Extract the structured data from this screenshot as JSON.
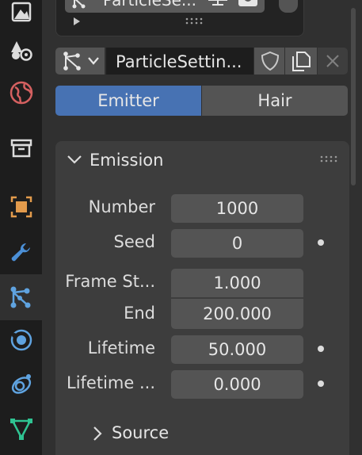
{
  "tabs": [
    {
      "icon": "render-icon"
    },
    {
      "icon": "scene-icon"
    },
    {
      "icon": "world-icon"
    },
    {
      "icon": "collection-icon"
    },
    {
      "icon": "object-icon"
    },
    {
      "icon": "modifier-icon"
    },
    {
      "icon": "particles-icon",
      "active": true
    },
    {
      "icon": "physics-icon"
    },
    {
      "icon": "constraints-icon"
    },
    {
      "icon": "data-icon"
    }
  ],
  "particle_list": {
    "item_label": "ParticleSe..."
  },
  "datablock": {
    "name": "ParticleSettin..."
  },
  "emission_type": {
    "options": [
      "Emitter",
      "Hair"
    ],
    "selected": "Emitter"
  },
  "emission": {
    "title": "Emission",
    "fields": [
      {
        "label": "Number",
        "value": "1000",
        "animatable": false
      },
      {
        "label": "Seed",
        "value": "0",
        "animatable": true
      },
      {
        "label": "Frame St...",
        "value": "1.000",
        "animatable": false
      },
      {
        "label": "End",
        "value": "200.000",
        "animatable": false
      },
      {
        "label": "Lifetime",
        "value": "50.000",
        "animatable": true
      },
      {
        "label": "Lifetime ...",
        "value": "0.000",
        "animatable": true
      }
    ],
    "source_subpanel": "Source"
  },
  "colors": {
    "accent": "#4772b3",
    "background": "#303030",
    "panel": "#3d3d3d",
    "field": "#545454"
  }
}
